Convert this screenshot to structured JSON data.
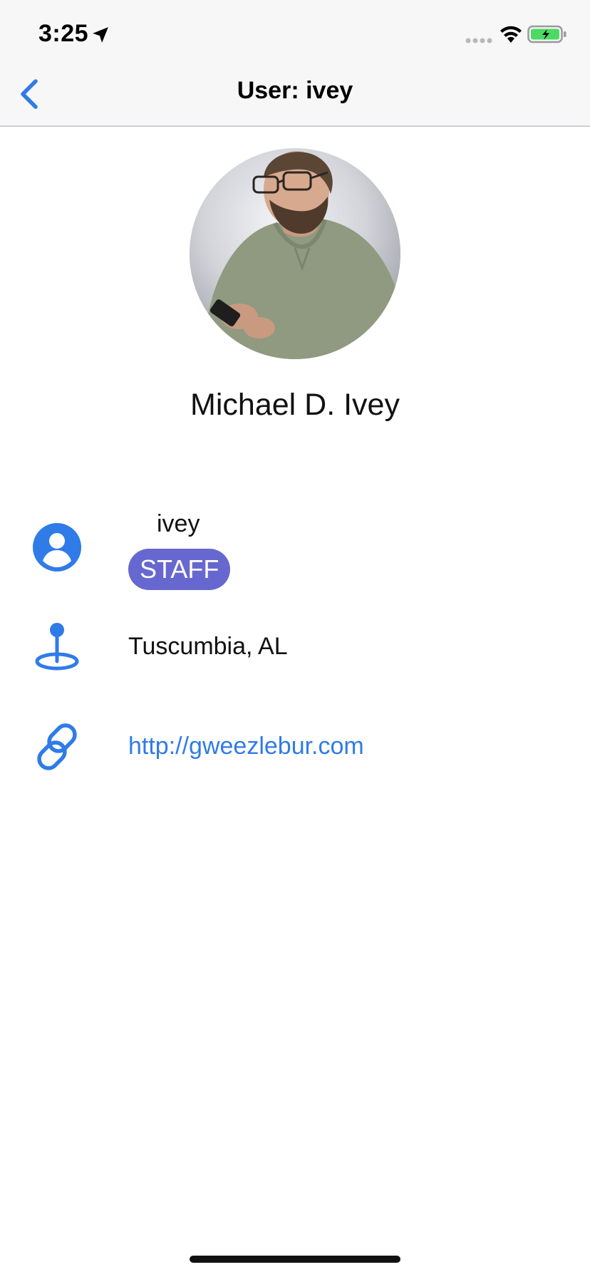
{
  "status_bar": {
    "time": "3:25",
    "icons": [
      "location-arrow-icon",
      "cellular-signal-icon",
      "wifi-icon",
      "battery-charging-icon"
    ]
  },
  "nav": {
    "title": "User: ivey",
    "back_icon": "chevron-left-icon"
  },
  "profile": {
    "name": "Michael D. Ivey",
    "avatar_icon": "profile-photo"
  },
  "details": {
    "username": "ivey",
    "badge": "STAFF",
    "location": "Tuscumbia, AL",
    "website": "http://gweezlebur.com",
    "icons": [
      "user-circle-icon",
      "map-pin-icon",
      "link-icon"
    ]
  },
  "colors": {
    "accent": "#2f7be8",
    "badge": "#6768cf",
    "navbar": "#f7f7f7",
    "battery_charge": "#4cd964"
  }
}
